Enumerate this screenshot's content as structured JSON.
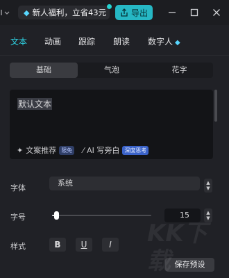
{
  "titlebar": {
    "promo_text": "新人福利，立省43元",
    "export_label": "导出"
  },
  "tabs": [
    {
      "label": "文本",
      "active": true
    },
    {
      "label": "动画",
      "active": false
    },
    {
      "label": "跟踪",
      "active": false
    },
    {
      "label": "朗读",
      "active": false
    },
    {
      "label": "数字人",
      "active": false
    }
  ],
  "segments": [
    {
      "label": "基础",
      "active": true
    },
    {
      "label": "气泡",
      "active": false
    },
    {
      "label": "花字",
      "active": false
    }
  ],
  "textbox": {
    "content": "默认文本"
  },
  "tools": {
    "copy_label": "文案推荐",
    "copy_badge": "限免",
    "ai_label": "AI 写旁白",
    "ai_badge": "深度思考"
  },
  "font": {
    "label": "字体",
    "value": "系统"
  },
  "size": {
    "label": "字号",
    "value": "15",
    "slider_fraction": 0.04
  },
  "style": {
    "label": "样式",
    "bold": "B",
    "underline": "U",
    "italic": "I"
  },
  "save_label": "保存预设",
  "colors": {
    "accent": "#2ed1e2",
    "export_bg": "#26b7c4",
    "panel_bg": "#202126"
  }
}
